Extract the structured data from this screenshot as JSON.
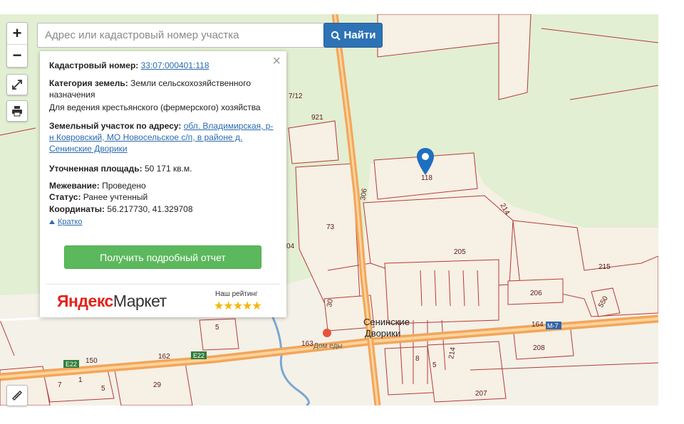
{
  "search": {
    "placeholder": "Адрес или кадастровый номер участка",
    "button_label": "Найти"
  },
  "controls": {
    "zoom_in": "+",
    "zoom_out": "−"
  },
  "info": {
    "cadastral_label": "Кадастровый номер:",
    "cadastral_value": "33:07:000401:118",
    "category_label": "Категория земель:",
    "category_value": "Земли сельскохозяйственного назначения",
    "usage_value": "Для ведения крестьянского (фермерского) хозяйства",
    "address_label": "Земельный участок по адресу:",
    "address_value": "обл. Владимирская, р-н Ковровский, МО Новосельское с/п, в районе д. Сенинские Дворики",
    "area_label": "Уточненная площадь:",
    "area_value": "50 171 кв.м.",
    "survey_label": "Межевание:",
    "survey_value": "Проведено",
    "status_label": "Статус:",
    "status_value": "Ранее учтенный",
    "coords_label": "Координаты:",
    "coords_value": "56.217730, 41.329708",
    "collapse_link": "Кратко",
    "report_button": "Получить подробный отчет"
  },
  "ad": {
    "brand_red": "Яндекс",
    "brand_dark": "Маркет",
    "rating_label": "Наш рейтинг",
    "stars": "★★★★★"
  },
  "map": {
    "parcel_labels": [
      "921",
      "7/12",
      "306",
      "118",
      "214",
      "73",
      "205",
      "215",
      "04",
      "206",
      "550",
      "30",
      "5",
      "164",
      "208",
      "162",
      "150",
      "163",
      "214",
      "5",
      "8",
      "29",
      "5",
      "7",
      "1",
      "207"
    ],
    "road_labels": [
      "E22",
      "E22",
      "M-7"
    ],
    "village_label": "Сенинские Дворики",
    "poi_label": "Дом еды"
  },
  "colors": {
    "accent_blue": "#2d73b5",
    "report_green": "#5cb85c",
    "map_green": "#e2efd2",
    "parcel_stroke": "#b53a3a",
    "road_orange": "#f0a050"
  }
}
